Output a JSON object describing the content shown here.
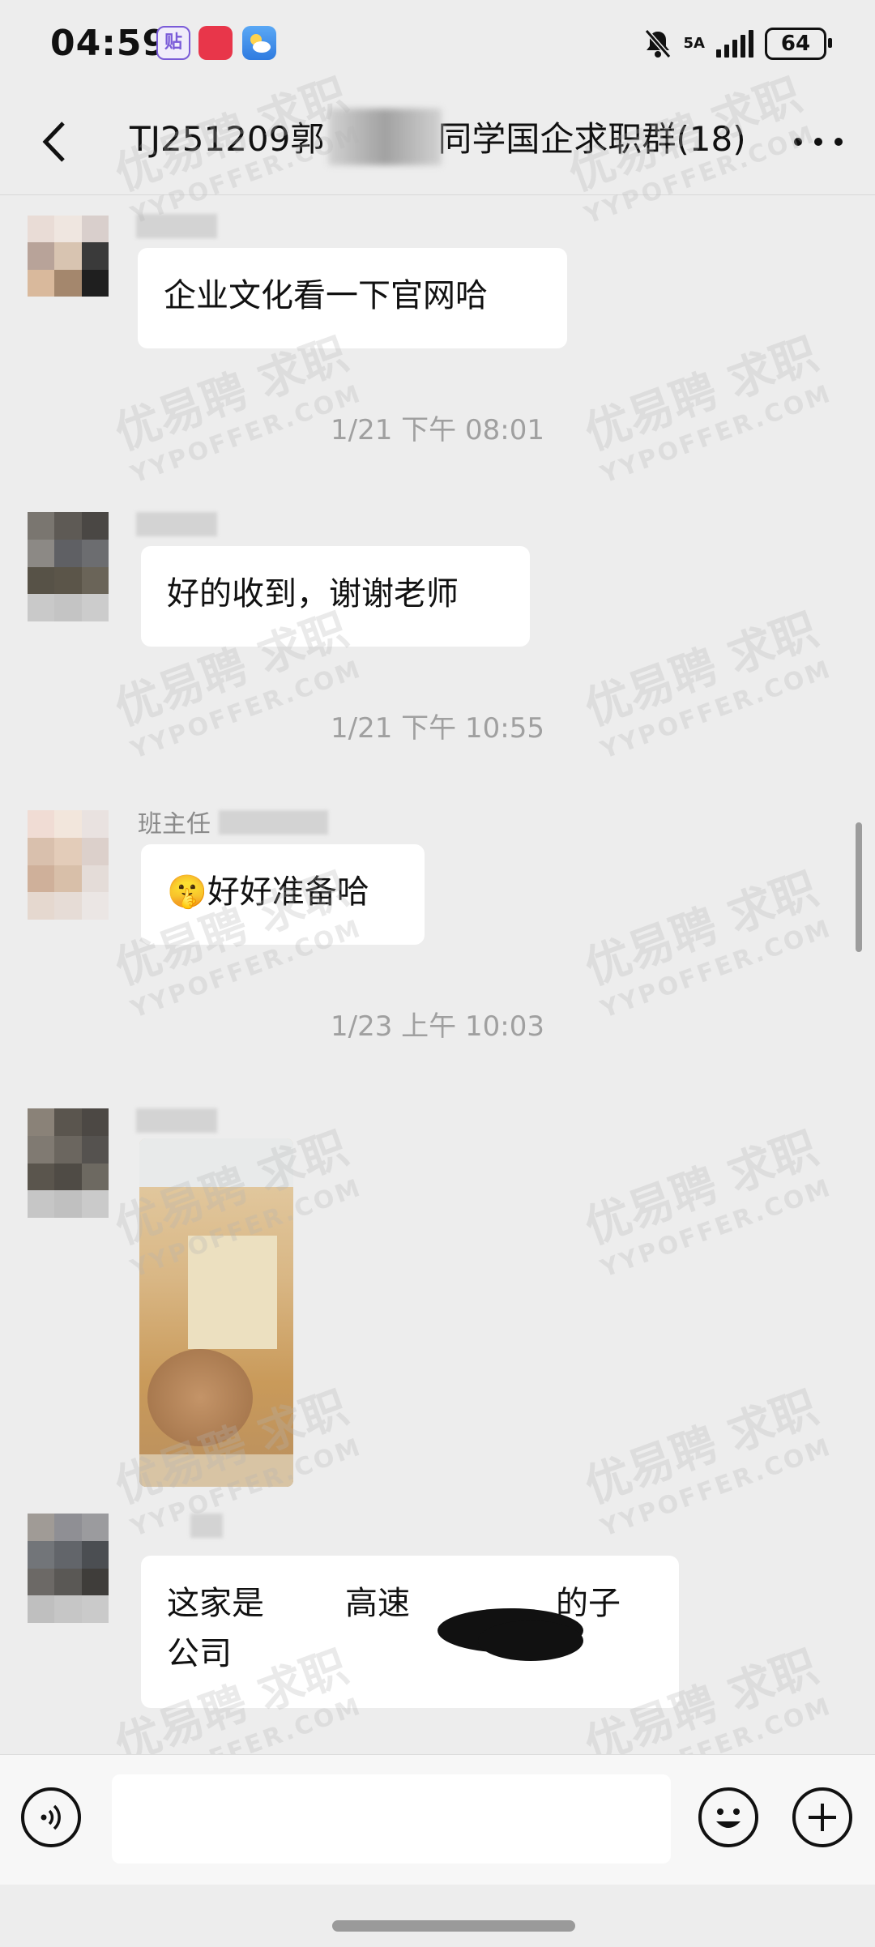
{
  "status_bar": {
    "time": "04:59",
    "network": "5A",
    "battery": "64",
    "icons": [
      "tieba-app-icon",
      "appgallery-app-icon",
      "weather-app-icon",
      "mute-bell-icon",
      "signal-icon",
      "battery-icon"
    ]
  },
  "header": {
    "title_left": "TJ251209郭",
    "title_right": "同学国企求职群(18)",
    "back_icon": "chevron-left-icon",
    "more_icon": "more-dots-icon"
  },
  "messages": [
    {
      "type": "text",
      "text": "企业文化看一下官网哈"
    },
    {
      "type": "timestamp",
      "text": "1/21 下午 08:01"
    },
    {
      "type": "text",
      "text": "好的收到，谢谢老师"
    },
    {
      "type": "timestamp",
      "text": "1/21 下午 10:55"
    },
    {
      "type": "text",
      "sender": "班主任",
      "emoji": "🤫",
      "text": "好好准备哈"
    },
    {
      "type": "timestamp",
      "text": "1/23 上午 10:03"
    },
    {
      "type": "image",
      "text": ""
    },
    {
      "type": "text",
      "line1_a": "这家是",
      "line1_b": "高速",
      "line1_c": "的子",
      "line2": "公司"
    }
  ],
  "watermark": {
    "brand": "优易聘 求职",
    "url": "YYPOFFER.COM"
  },
  "input_bar": {
    "placeholder": "",
    "voice_icon": "voice-icon",
    "emoji_icon": "emoji-icon",
    "plus_icon": "plus-icon"
  },
  "colors": {
    "background": "#ededed",
    "bubble": "#ffffff",
    "timestamp": "#a0a0a0"
  }
}
